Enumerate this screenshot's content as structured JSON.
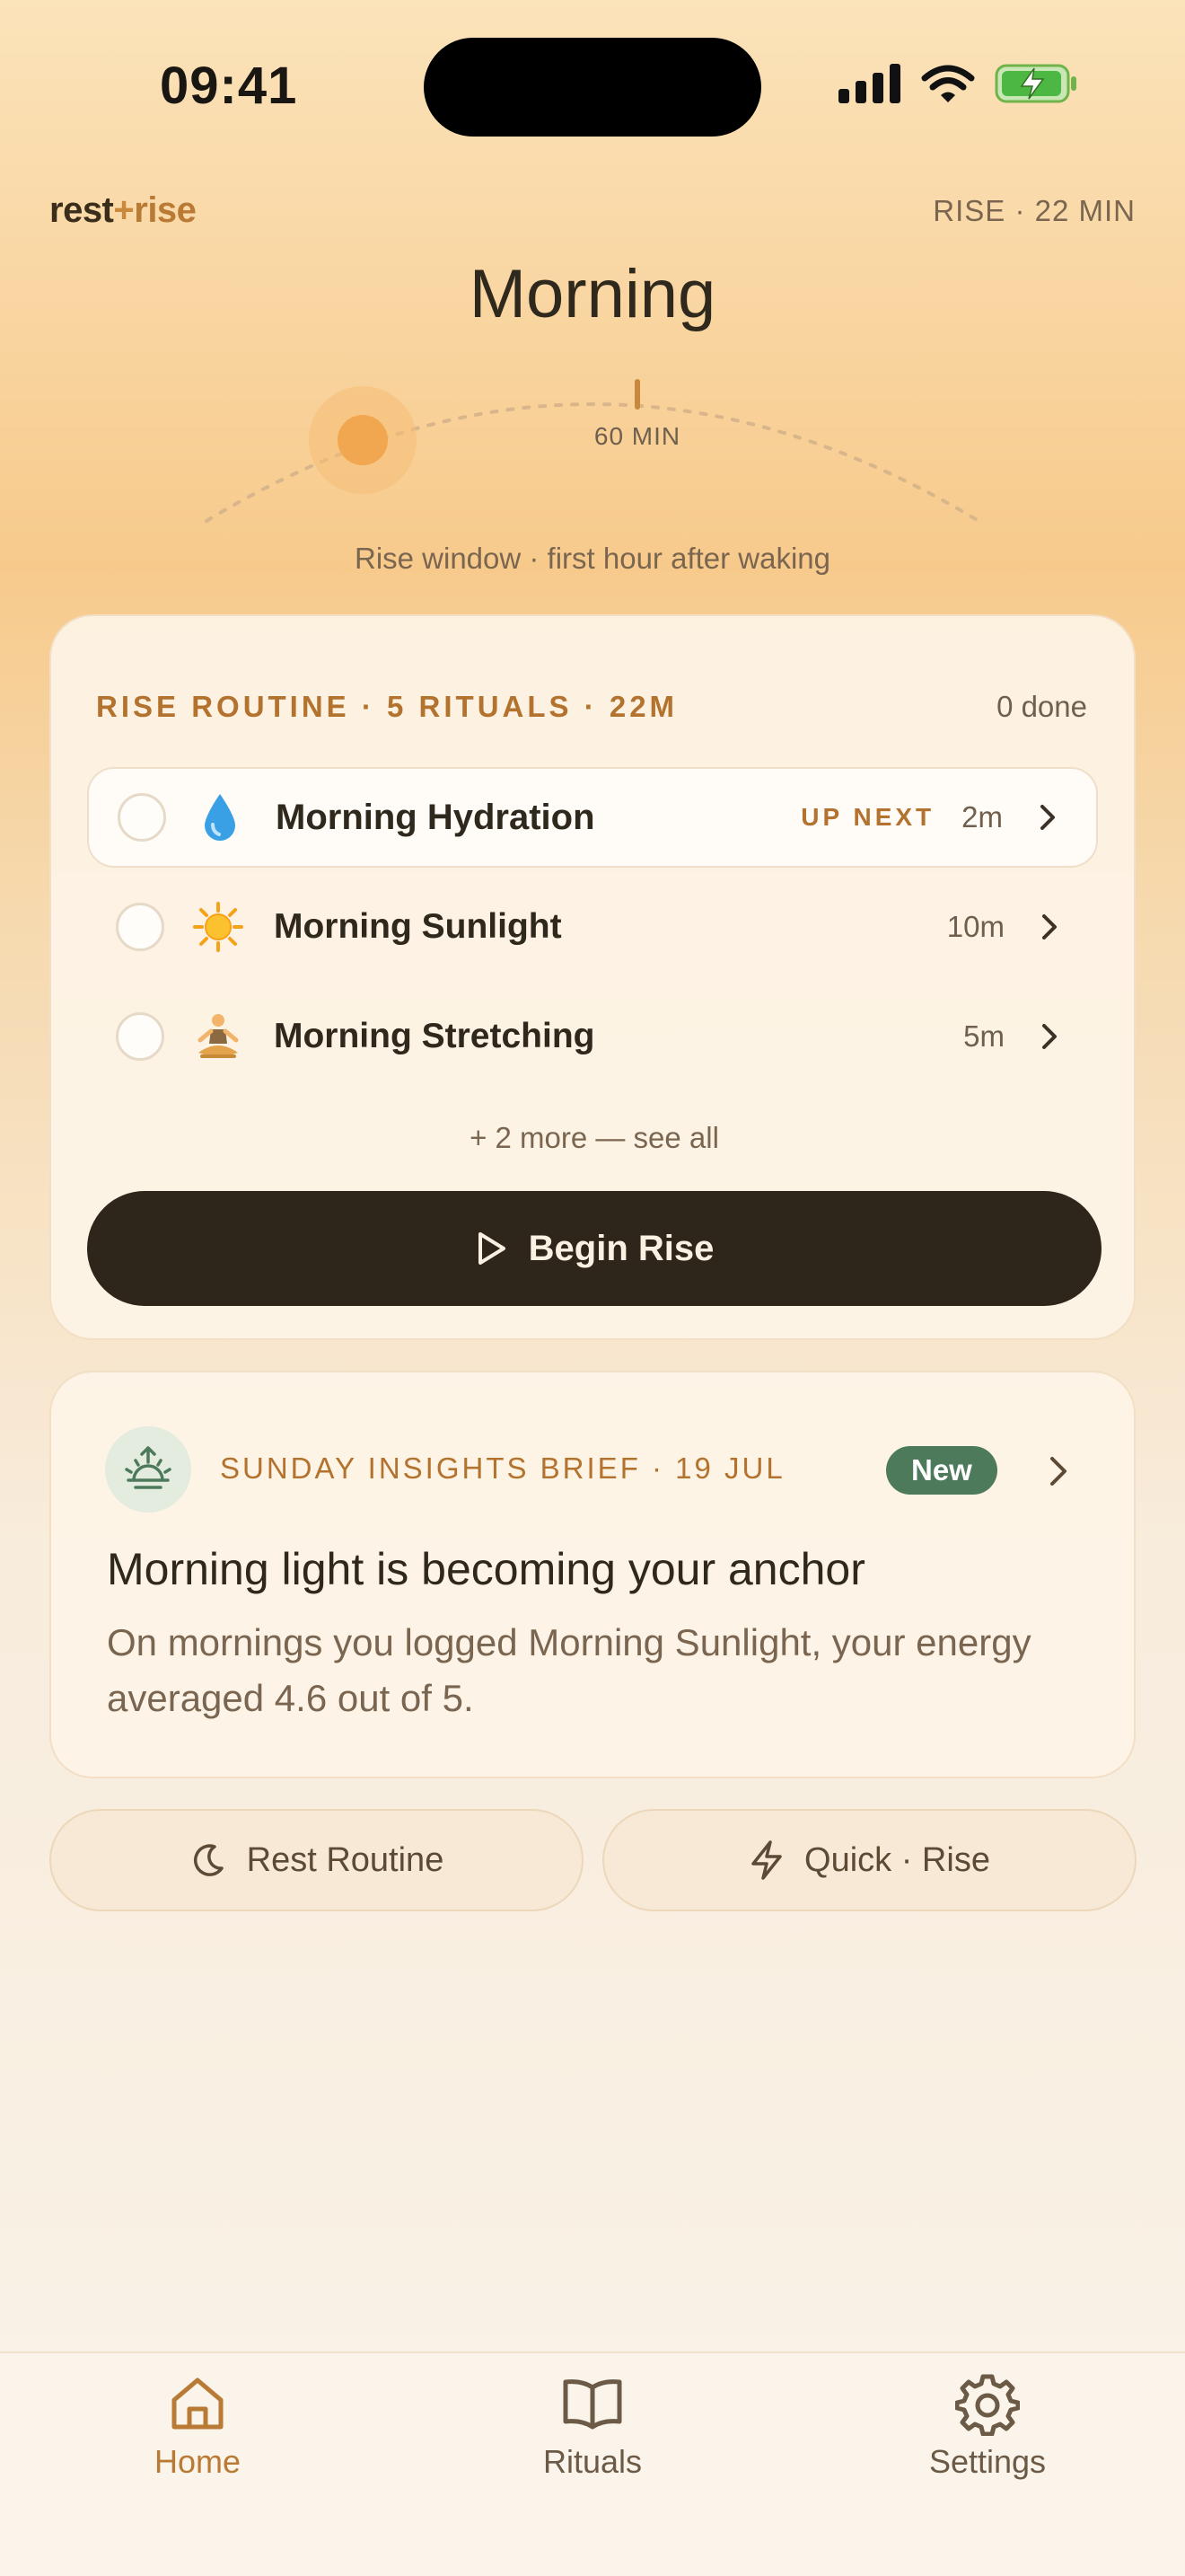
{
  "status": {
    "time": "09:41"
  },
  "header": {
    "brand_rest": "rest",
    "brand_plus": "+",
    "brand_rise": "rise",
    "meta": "RISE · 22 MIN",
    "title": "Morning"
  },
  "arc": {
    "marker_label": "60 MIN",
    "caption": "Rise window · first hour after waking"
  },
  "routine": {
    "heading": "RISE ROUTINE · 5 RITUALS · 22M",
    "done_label": "0 done",
    "rituals": [
      {
        "name": "Morning Hydration",
        "badge": "UP NEXT",
        "duration": "2m",
        "icon": "water-drop-icon"
      },
      {
        "name": "Morning Sunlight",
        "duration": "10m",
        "icon": "sun-icon"
      },
      {
        "name": "Morning Stretching",
        "duration": "5m",
        "icon": "meditation-icon"
      }
    ],
    "more_link": "+ 2 more — see all",
    "begin_label": "Begin Rise"
  },
  "insight": {
    "label": "SUNDAY INSIGHTS BRIEF · 19 JUL",
    "badge": "New",
    "title": "Morning light is becoming your anchor",
    "body": "On mornings you logged Morning Sunlight, your energy averaged 4.6 out of 5."
  },
  "quick_actions": {
    "rest_label": "Rest Routine",
    "quick_label": "Quick · Rise"
  },
  "nav": {
    "home": "Home",
    "rituals": "Rituals",
    "settings": "Settings"
  },
  "colors": {
    "accent": "#b87a34",
    "dark_button": "#2e261a",
    "badge_green": "#4e7a5c",
    "sun_dot": "#f0a74f"
  }
}
